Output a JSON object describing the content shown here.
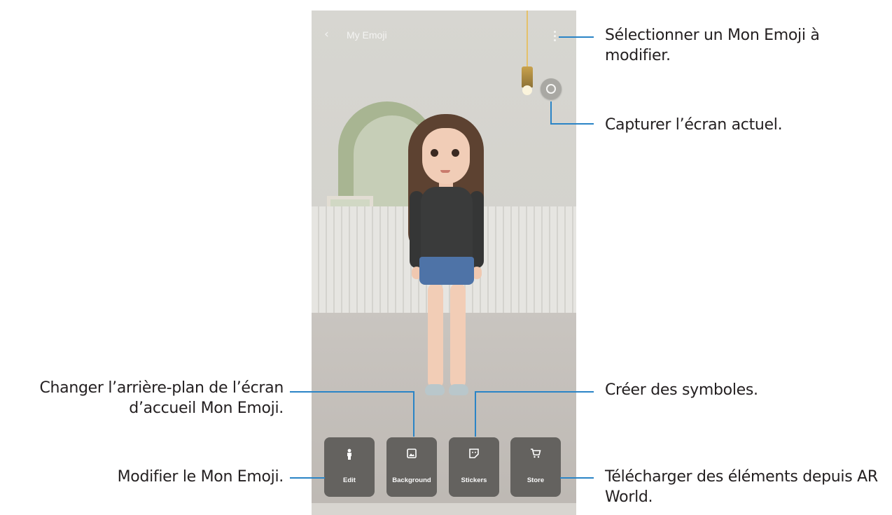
{
  "phone": {
    "title": "My Emoji",
    "back_icon": "back-chevron-icon",
    "actions": [
      {
        "label": "Edit",
        "icon": "person-icon"
      },
      {
        "label": "Background",
        "icon": "image-icon"
      },
      {
        "label": "Stickers",
        "icon": "sticker-icon"
      },
      {
        "label": "Store",
        "icon": "cart-icon"
      }
    ]
  },
  "callouts": {
    "select_emoji": "Sélectionner un Mon Emoji à modifier.",
    "capture": "Capturer l’écran actuel.",
    "change_background": "Changer l’arrière-plan de l’écran d’accueil Mon Emoji.",
    "create_stickers": "Créer des symboles.",
    "edit_emoji": "Modifier le Mon Emoji.",
    "download_items": "Télécharger des éléments depuis AR World."
  },
  "colors": {
    "callout_line": "#2a84c6",
    "button_bg": "#64625f"
  }
}
